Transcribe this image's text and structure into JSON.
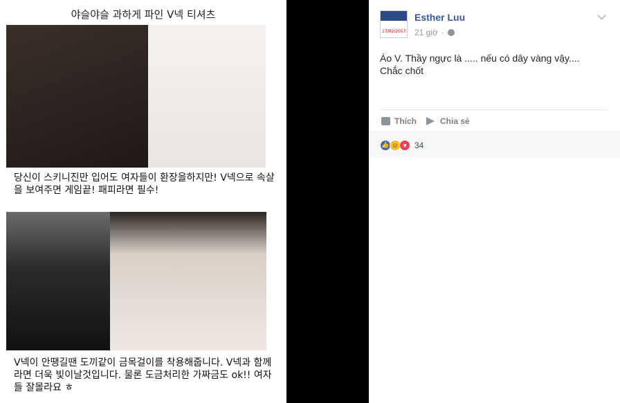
{
  "photo": {
    "title": "야슬야슬 과하게 파인 V넥 티셔츠",
    "caption_top": "당신이 스키니진만 입어도 여자들이 환장을하지만! V넥으로 속살을 보여주면 게임끝! 패피라면 필수!",
    "caption_bottom": "V넥이 안땡길땐 도끼같이 금목걸이를 착용해줍니다. V넥과 함께라면 더욱 빛이날것입니다. 물론 도금처리한 가짜금도 ok!! 여자들 잘몰라요 ㅎ"
  },
  "post": {
    "author": "Esther Luu",
    "avatar_text": "17/02/2017",
    "time": "21 giờ",
    "privacy_icon": "globe-icon",
    "menu_icon": "chevron-down-icon",
    "text": "Áo V. Thầy ngực là ..... nếu có dây vàng vậy.... Chắc chốt",
    "actions": {
      "like_label": "Thích",
      "share_label": "Chia sẻ"
    },
    "reactions": {
      "count": "34",
      "types": [
        "like",
        "haha",
        "love"
      ]
    }
  }
}
